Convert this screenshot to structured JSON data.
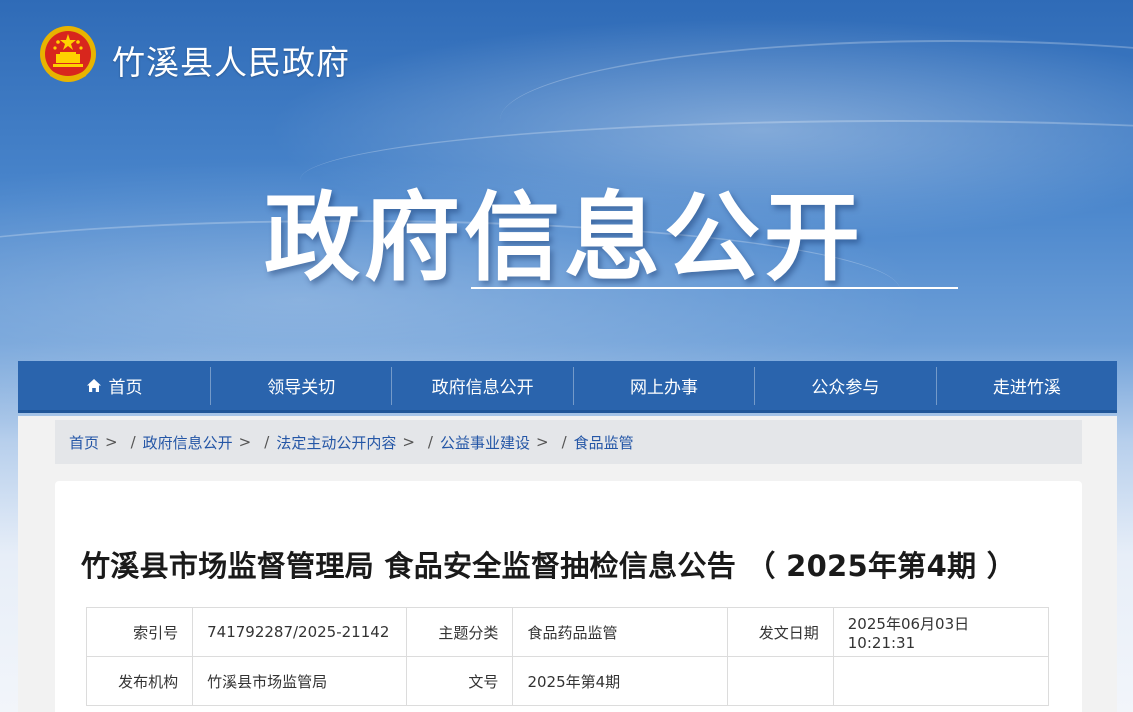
{
  "site": {
    "name": "竹溪县人民政府"
  },
  "hero": {
    "title": "政府信息公开"
  },
  "nav": {
    "items": [
      {
        "label": "首页",
        "icon": "home-icon"
      },
      {
        "label": "领导关切"
      },
      {
        "label": "政府信息公开"
      },
      {
        "label": "网上办事"
      },
      {
        "label": "公众参与"
      },
      {
        "label": "走进竹溪"
      }
    ]
  },
  "breadcrumb": [
    "首页",
    "政府信息公开",
    "法定主动公开内容",
    "公益事业建设",
    "食品监管"
  ],
  "article": {
    "title": "竹溪县市场监督管理局 食品安全监督抽检信息公告 （ 2025年第4期 ）",
    "meta": {
      "index_label": "索引号",
      "index_value": "741792287/2025-21142",
      "topic_label": "主题分类",
      "topic_value": "食品药品监管",
      "date_label": "发文日期",
      "date_value": "2025年06月03日 10:21:31",
      "publisher_label": "发布机构",
      "publisher_value": "竹溪县市场监管局",
      "docno_label": "文号",
      "docno_value": "2025年第4期"
    }
  },
  "colors": {
    "nav": "#2a64ad",
    "link": "#2456a6"
  }
}
